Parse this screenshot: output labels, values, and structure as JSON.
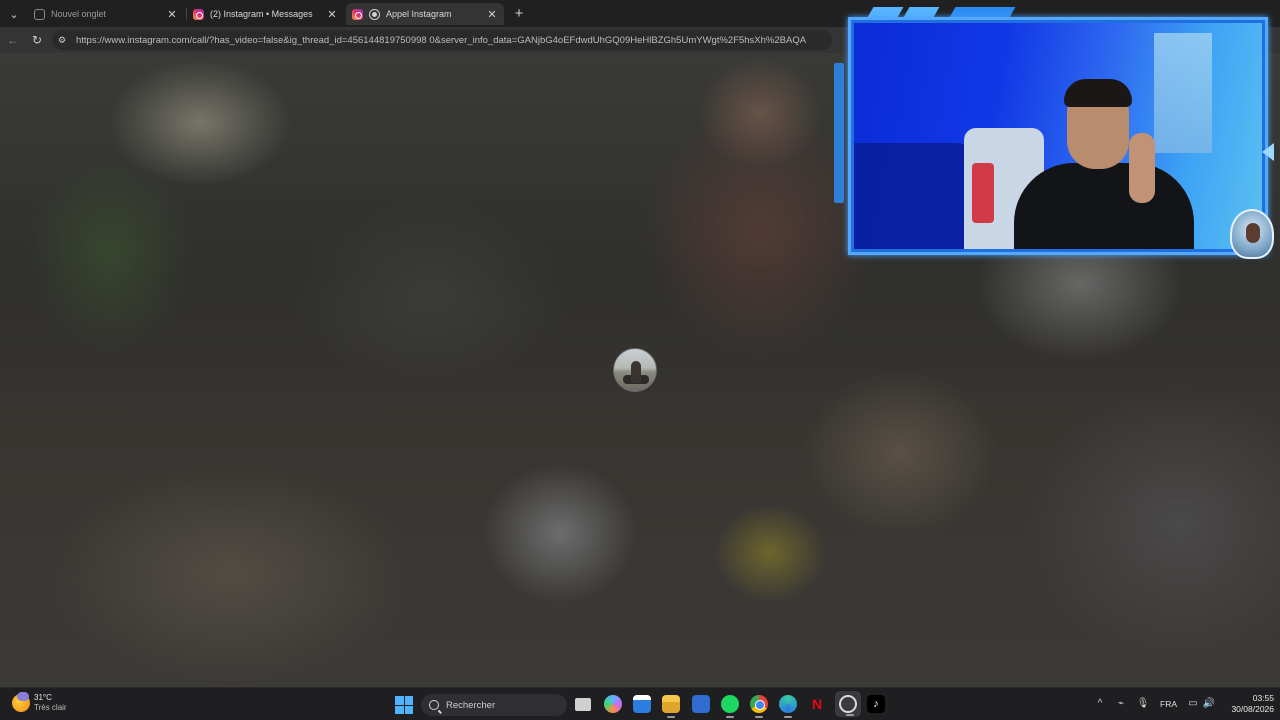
{
  "browser": {
    "tabs": [
      {
        "title": "Nouvel onglet",
        "icon": "page-icon",
        "state": "inactive"
      },
      {
        "title": "(2) Instagram • Messages",
        "icon": "instagram-icon",
        "state": "inactive"
      },
      {
        "title": "Appel Instagram",
        "icon": "recording-icon",
        "state": "active"
      }
    ],
    "close_glyph": "✕",
    "new_tab_glyph": "+",
    "address": {
      "url": "https://www.instagram.com/call/?has_video=false&ig_thread_id=456144819750998 0&server_info_data=GANjbG4oEFdwdUhGQ09HeHlBZGh5UmYWgt%2F5hsXh%2BAQA"
    }
  },
  "taskbar": {
    "weather": {
      "temperature": "31°C",
      "condition": "Très clair"
    },
    "search_placeholder": "Rechercher",
    "language": "FRA",
    "clock": {
      "time": "03:55",
      "date": "30/08/2026"
    }
  },
  "colors": {
    "accent": "#4fb3ff",
    "webcam_frame": "#55a8ff",
    "spotify": "#1ed760",
    "netflix": "#e50914"
  }
}
